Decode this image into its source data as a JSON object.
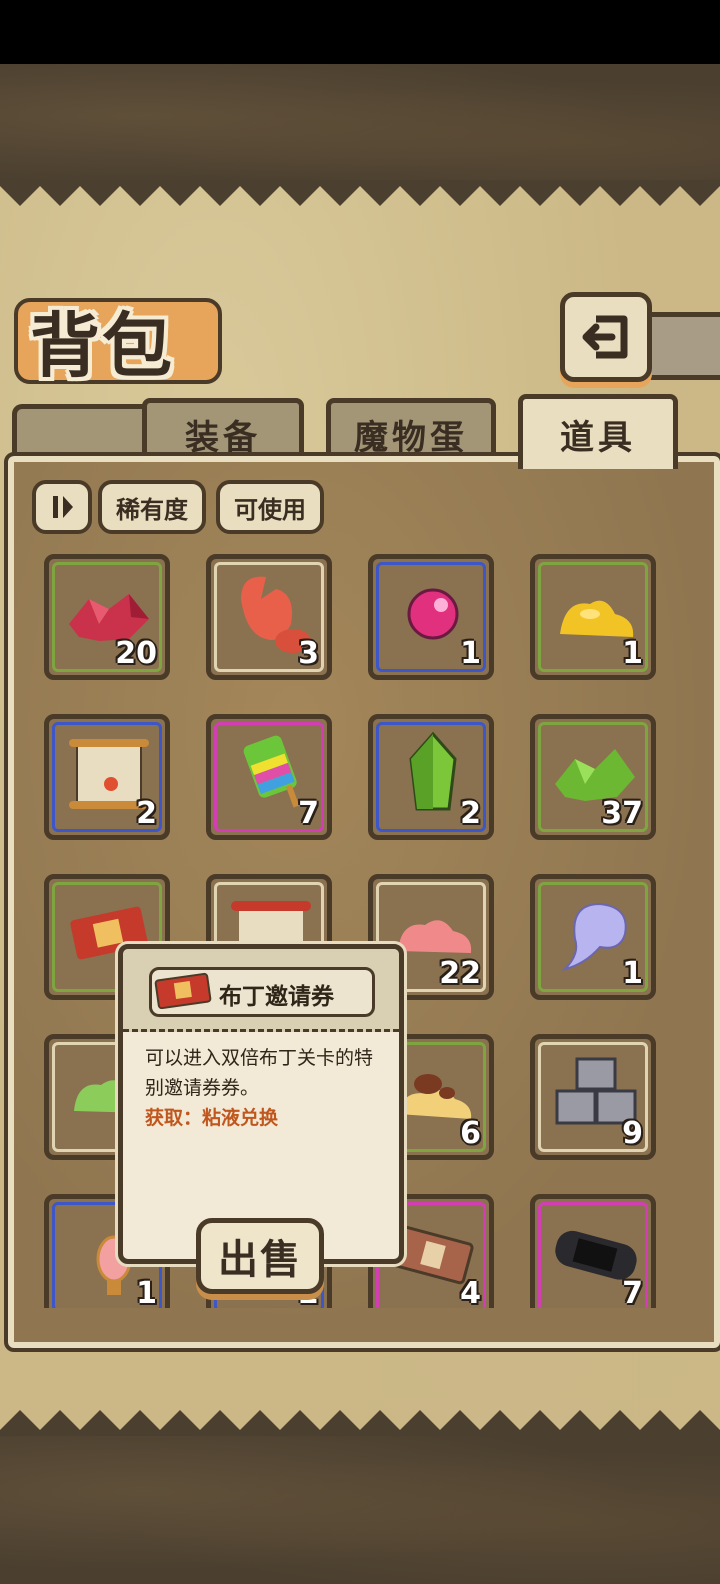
{
  "header": {
    "title": "背包"
  },
  "tabs": [
    {
      "label": "装备",
      "active": false
    },
    {
      "label": "魔物蛋",
      "active": false
    },
    {
      "label": "道具",
      "active": true
    }
  ],
  "filters": {
    "sort_icon": "sort-icon",
    "rarity_label": "稀有度",
    "usable_label": "可使用"
  },
  "items": [
    {
      "name": "red-crystal-shards",
      "count": "20",
      "rarity": "green"
    },
    {
      "name": "crab-claw",
      "count": "3",
      "rarity": "beige"
    },
    {
      "name": "pink-orb",
      "count": "1",
      "rarity": "blue"
    },
    {
      "name": "yellow-slime",
      "count": "1",
      "rarity": "green"
    },
    {
      "name": "scroll",
      "count": "2",
      "rarity": "blue"
    },
    {
      "name": "rainbow-popsicle",
      "count": "7",
      "rarity": "pink"
    },
    {
      "name": "green-crystal",
      "count": "2",
      "rarity": "blue"
    },
    {
      "name": "green-crystal-shards",
      "count": "37",
      "rarity": "green"
    },
    {
      "name": "pudding-ticket",
      "count": "",
      "rarity": "green"
    },
    {
      "name": "red-scroll",
      "count": "",
      "rarity": "beige"
    },
    {
      "name": "pink-slime",
      "count": "22",
      "rarity": "beige"
    },
    {
      "name": "ghost-spirit",
      "count": "1",
      "rarity": "green"
    },
    {
      "name": "green-slime",
      "count": "",
      "rarity": "beige"
    },
    {
      "name": "unknown-item",
      "count": "",
      "rarity": "green"
    },
    {
      "name": "chocolate-slime",
      "count": "6",
      "rarity": "green"
    },
    {
      "name": "stone-blocks",
      "count": "9",
      "rarity": "beige"
    },
    {
      "name": "lamp",
      "count": "1",
      "rarity": "blue"
    },
    {
      "name": "golden-item",
      "count": "2",
      "rarity": "blue"
    },
    {
      "name": "hammer-ticket",
      "count": "4",
      "rarity": "pink"
    },
    {
      "name": "game-console",
      "count": "7",
      "rarity": "pink"
    }
  ],
  "tooltip": {
    "title": "布丁邀请券",
    "description": "可以进入双倍布丁关卡的特别邀请券券。",
    "source": "获取：粘液兑换"
  },
  "sell_button": {
    "label": "出售"
  },
  "colors": {
    "green": "#7ea53f",
    "blue": "#3d57c9",
    "beige": "#e0d4b2",
    "pink": "#d13fb3",
    "source_text": "#c0571e"
  }
}
